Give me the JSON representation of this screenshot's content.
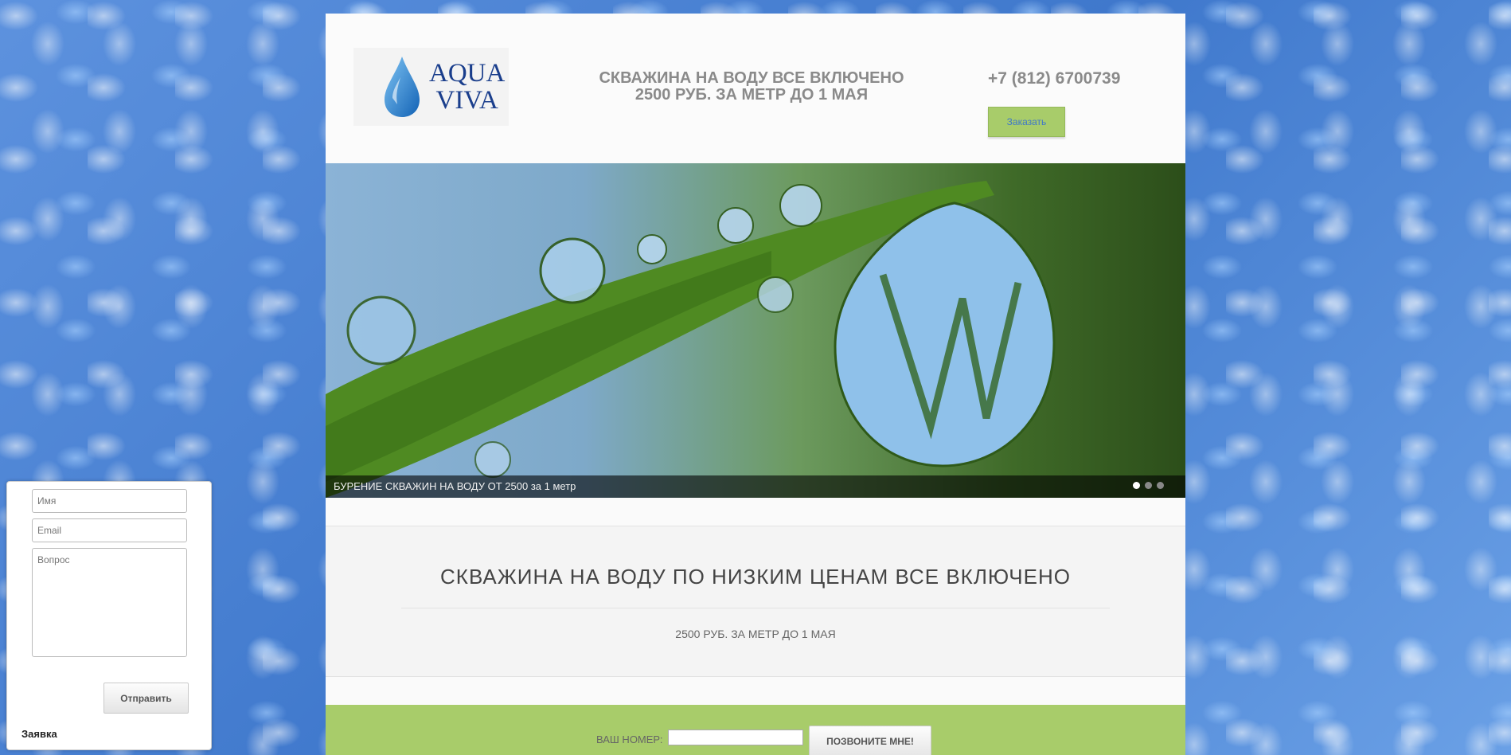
{
  "colors": {
    "accent_green": "#a8cc6a",
    "water_blue": "#4f86d6",
    "logo_blue": "#1a3e8c",
    "link_blue": "#3f77c9"
  },
  "header": {
    "logo_text_line1": "AQUA",
    "logo_text_line2": "VIVA",
    "headline_line1": "СКВАЖИНА НА ВОДУ ВСЕ ВКЛЮЧЕНО",
    "headline_line2": "2500 РУБ. ЗА МЕТР ДО 1 МАЯ",
    "phone": "+7 (812) 6700739",
    "order_button": "Заказать"
  },
  "slider": {
    "caption": "БУРЕНИЕ СКВАЖИН НА ВОДУ ОТ 2500 за 1 метр",
    "dots": 3,
    "active_dot": 1
  },
  "promo": {
    "heading": "СКВАЖИНА НА ВОДУ ПО НИЗКИМ ЦЕНАМ ВСЕ ВКЛЮЧЕНО",
    "subheading": "2500 РУБ. ЗА МЕТР ДО 1 МАЯ"
  },
  "callback": {
    "label": "ВАШ НОМЕР:",
    "input_value": "",
    "button": "ПОЗВОНИТЕ МНЕ!"
  },
  "request_widget": {
    "name_placeholder": "Имя",
    "email_placeholder": "Email",
    "question_placeholder": "Вопрос",
    "send_button": "Отправить",
    "title": "Заявка"
  }
}
